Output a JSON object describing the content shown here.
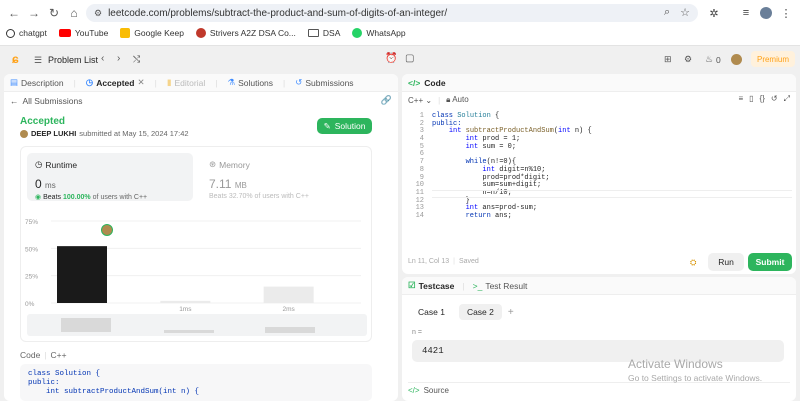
{
  "browser": {
    "url": "leetcode.com/problems/subtract-the-product-and-sum-of-digits-of-an-integer/",
    "bookmarks": [
      {
        "label": "chatgpt",
        "icon": "chatgpt-icon",
        "color": "#333333"
      },
      {
        "label": "YouTube",
        "icon": "youtube-icon",
        "color": "#ff0000"
      },
      {
        "label": "Google Keep",
        "icon": "keep-icon",
        "color": "#f9bc05"
      },
      {
        "label": "Strivers A2Z DSA Co...",
        "icon": "strivers-icon",
        "color": "#c0392b"
      },
      {
        "label": "DSA",
        "icon": "folder-icon",
        "color": "#555555"
      },
      {
        "label": "WhatsApp",
        "icon": "whatsapp-icon",
        "color": "#25d366"
      }
    ]
  },
  "topbar": {
    "problem_list": "Problem List",
    "premium": "Premium",
    "streak": "0"
  },
  "left": {
    "tabs": [
      "Description",
      "Accepted",
      "Editorial",
      "Solutions",
      "Submissions"
    ],
    "all_submissions": "All Submissions",
    "status": "Accepted",
    "user": "DEEP LUKHI",
    "submitted_text": "submitted at May 15, 2024 17:42",
    "solution_btn": "Solution",
    "runtime_label": "Runtime",
    "runtime_value": "0",
    "runtime_unit": "ms",
    "runtime_beats": "Beats",
    "runtime_pct": "100.00%",
    "runtime_suffix": "of users with C++",
    "memory_label": "Memory",
    "memory_value": "7.11",
    "memory_unit": "MB",
    "memory_beats": "Beats 32.70% of users with C++",
    "code_label": "Code",
    "code_lang": "C++",
    "preview_lines": [
      "class Solution {",
      "public:",
      "    int subtractProductAndSum(int n) {"
    ]
  },
  "chart_data": {
    "type": "bar",
    "categories": [
      "",
      "1ms",
      "2ms"
    ],
    "values": [
      52,
      2,
      15
    ],
    "yticks": [
      "75%",
      "50%",
      "25%",
      "0%"
    ],
    "ylim": [
      0,
      75
    ]
  },
  "editor": {
    "title": "Code",
    "lang": "C++",
    "mode": "Auto",
    "lines": [
      "class Solution {",
      "public:",
      "    int subtractProductAndSum(int n) {",
      "        int prod = 1;",
      "        int sum = 0;",
      "",
      "        while(n!=0){",
      "            int digit=n%10;",
      "            prod=prod*digit;",
      "            sum=sum+digit;",
      "            n=n/10;",
      "        }",
      "        int ans=prod-sum;",
      "        return ans;"
    ],
    "status": "Ln 11, Col 13",
    "saved": "Saved",
    "run": "Run",
    "submit": "Submit"
  },
  "testcase": {
    "tab1": "Testcase",
    "tab2": "Test Result",
    "cases": [
      "Case 1",
      "Case 2"
    ],
    "var_label": "n =",
    "value": "4421",
    "source": "Source"
  },
  "watermark": {
    "title": "Activate Windows",
    "subtitle": "Go to Settings to activate Windows."
  }
}
